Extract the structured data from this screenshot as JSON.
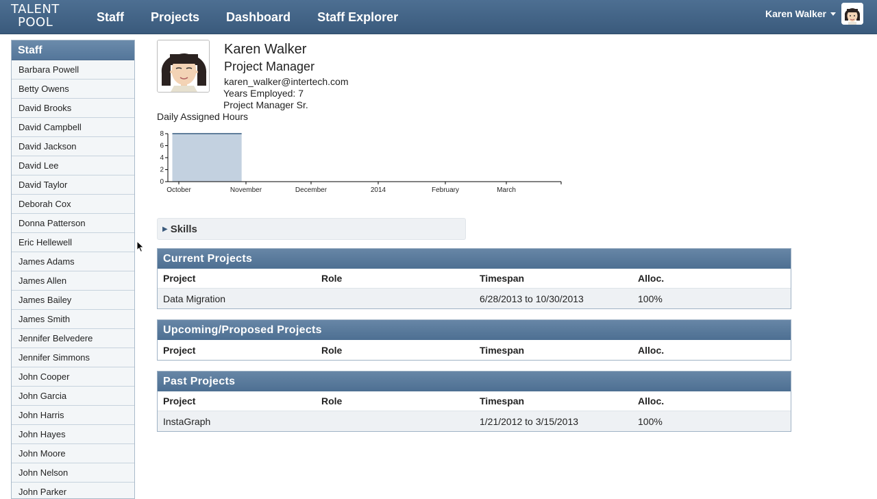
{
  "logo": {
    "line1": "TALENT",
    "line2": "POOL"
  },
  "nav": {
    "items": [
      "Staff",
      "Projects",
      "Dashboard",
      "Staff Explorer"
    ]
  },
  "user": {
    "name": "Karen Walker"
  },
  "sidebar": {
    "title": "Staff",
    "items": [
      "Barbara Powell",
      "Betty Owens",
      "David Brooks",
      "David Campbell",
      "David Jackson",
      "David Lee",
      "David Taylor",
      "Deborah Cox",
      "Donna Patterson",
      "Eric Hellewell",
      "James Adams",
      "James Allen",
      "James Bailey",
      "James Smith",
      "Jennifer Belvedere",
      "Jennifer Simmons",
      "John Cooper",
      "John Garcia",
      "John Harris",
      "John Hayes",
      "John Moore",
      "John Nelson",
      "John Parker"
    ]
  },
  "profile": {
    "name": "Karen Walker",
    "title": "Project Manager",
    "email": "karen_walker@intertech.com",
    "years": "Years Employed: 7",
    "level": "Project Manager Sr."
  },
  "chart_data": {
    "type": "area",
    "title": "Daily Assigned Hours",
    "xlabel": "",
    "ylabel": "",
    "ylim": [
      0,
      8
    ],
    "yticks": [
      0,
      2,
      4,
      6,
      8
    ],
    "xticks": [
      "October",
      "November",
      "December",
      "2014",
      "February",
      "March"
    ],
    "series": [
      {
        "start": "2013-09-28",
        "end": "2013-10-30",
        "value": 8
      }
    ],
    "color": "#c3d1e0",
    "line_color": "#5f7d9a"
  },
  "skills": {
    "label": "Skills"
  },
  "columns": {
    "project": "Project",
    "role": "Role",
    "timespan": "Timespan",
    "alloc": "Alloc."
  },
  "current": {
    "title": "Current Projects",
    "rows": [
      {
        "project": "Data Migration",
        "role": "",
        "timespan": "6/28/2013 to 10/30/2013",
        "alloc": "100%"
      }
    ]
  },
  "upcoming": {
    "title": "Upcoming/Proposed Projects",
    "rows": []
  },
  "past": {
    "title": "Past Projects",
    "rows": [
      {
        "project": "InstaGraph",
        "role": "",
        "timespan": "1/21/2012 to 3/15/2013",
        "alloc": "100%"
      }
    ]
  }
}
